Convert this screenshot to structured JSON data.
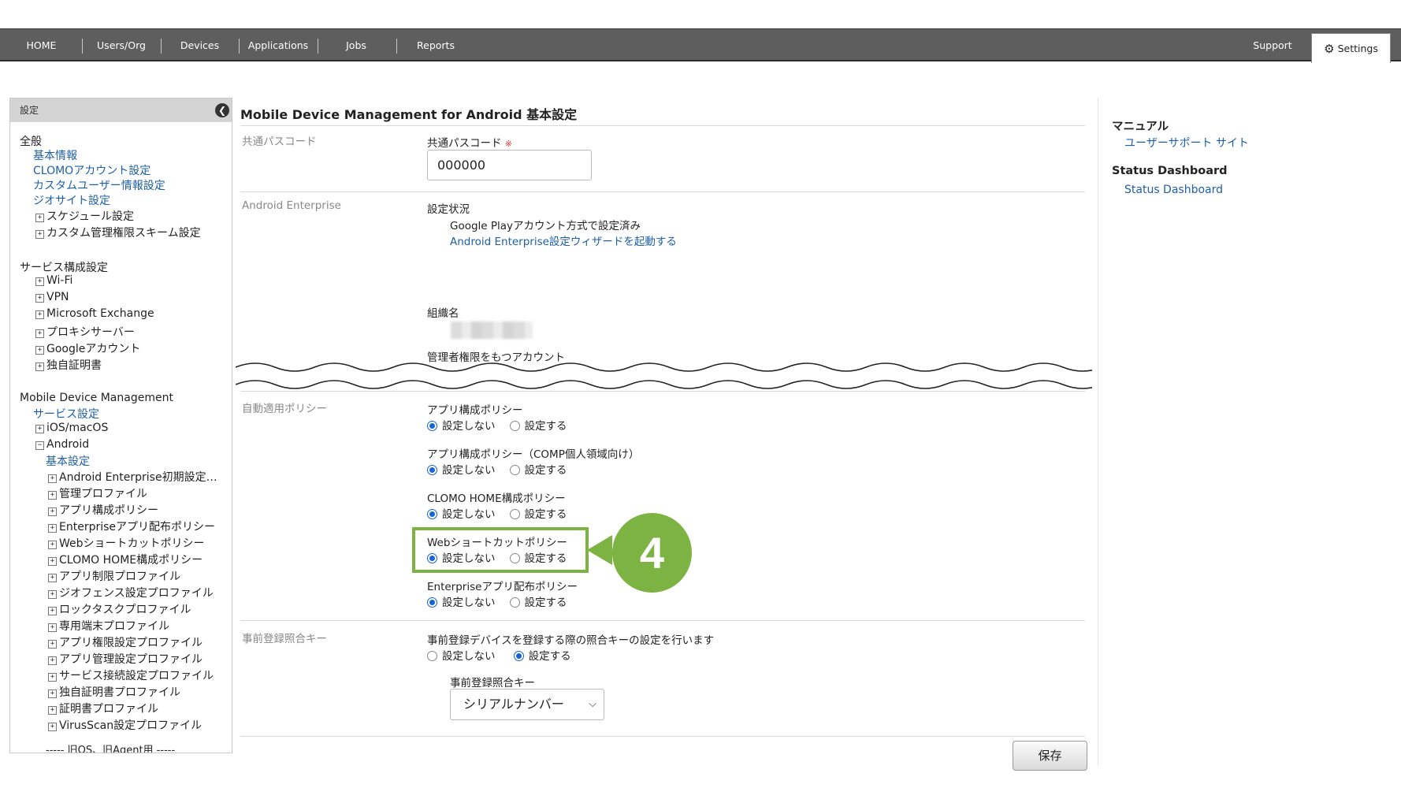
{
  "nav": {
    "home": "HOME",
    "users_org": "Users/Org",
    "devices": "Devices",
    "applications": "Applications",
    "jobs": "Jobs",
    "reports": "Reports",
    "support": "Support",
    "settings": "Settings"
  },
  "sidebar": {
    "header": "設定",
    "general_heading": "全般",
    "general_links": [
      "基本情報",
      "CLOMOアカウント設定",
      "カスタムユーザー情報設定",
      "ジオサイト設定"
    ],
    "general_expandables": [
      "スケジュール設定",
      "カスタム管理権限スキーム設定"
    ],
    "service_heading": "サービス構成設定",
    "service_items": [
      "Wi-Fi",
      "VPN",
      "Microsoft Exchange",
      "プロキシサーバー",
      "Googleアカウント",
      "独自証明書"
    ],
    "mdm_heading": "Mobile Device Management",
    "mdm_service_link": "サービス設定",
    "ios_macos": "iOS/macOS",
    "android": "Android",
    "android_basic_link": "基本設定",
    "android_items": [
      "Android Enterprise初期設定…",
      "管理プロファイル",
      "アプリ構成ポリシー",
      "Enterpriseアプリ配布ポリシー",
      "Webショートカットポリシー",
      "CLOMO HOME構成ポリシー",
      "アプリ制限プロファイル",
      "ジオフェンス設定プロファイル",
      "ロックタスクプロファイル",
      "専用端末プロファイル",
      "アプリ権限設定プロファイル",
      "アプリ管理設定プロファイル",
      "サービス接続設定プロファイル",
      "独自証明書プロファイル",
      "証明書プロファイル",
      "VirusScan設定プロファイル"
    ],
    "legacy_divider": "----- 旧OS、旧Agent用 -----"
  },
  "main": {
    "title": "Mobile Device Management for Android 基本設定",
    "passcode_section": "共通パスコード",
    "passcode_label": "共通パスコード",
    "required_mark": "※",
    "passcode_value": "000000",
    "ae_section": "Android Enterprise",
    "status_label": "設定状況",
    "status_value": "Google Playアカウント方式で設定済み",
    "wizard_link": "Android Enterprise設定ウィザードを起動する",
    "org_label": "組織名",
    "admin_label": "管理者権限をもつアカウント",
    "auto_section": "自動適用ポリシー",
    "policies": [
      {
        "label": "アプリ構成ポリシー",
        "selected": "設定しない"
      },
      {
        "label": "アプリ構成ポリシー（COMP個人領域向け）",
        "selected": "設定しない"
      },
      {
        "label": "CLOMO HOME構成ポリシー",
        "selected": "設定しない"
      },
      {
        "label": "Webショートカットポリシー",
        "selected": "設定しない"
      },
      {
        "label": "Enterpriseアプリ配布ポリシー",
        "selected": "設定しない"
      }
    ],
    "opt_off": "設定しない",
    "opt_on": "設定する",
    "prereg_section": "事前登録照合キー",
    "prereg_desc": "事前登録デバイスを登録する際の照合キーの設定を行います",
    "prereg_selected": "設定する",
    "prereg_key_label": "事前登録照合キー",
    "prereg_key_value": "シリアルナンバー",
    "save_button": "保存"
  },
  "callout": {
    "number": "4",
    "color": "#7cb342"
  },
  "right_panel": {
    "manual_heading": "マニュアル",
    "manual_link": "ユーザーサポート サイト",
    "status_heading": "Status Dashboard",
    "status_link": "Status Dashboard"
  },
  "colors": {
    "nav_bg": "#5e5e5e",
    "link": "#1d5fa8",
    "radio_selected": "#1763d6",
    "highlight": "#7cb342"
  }
}
